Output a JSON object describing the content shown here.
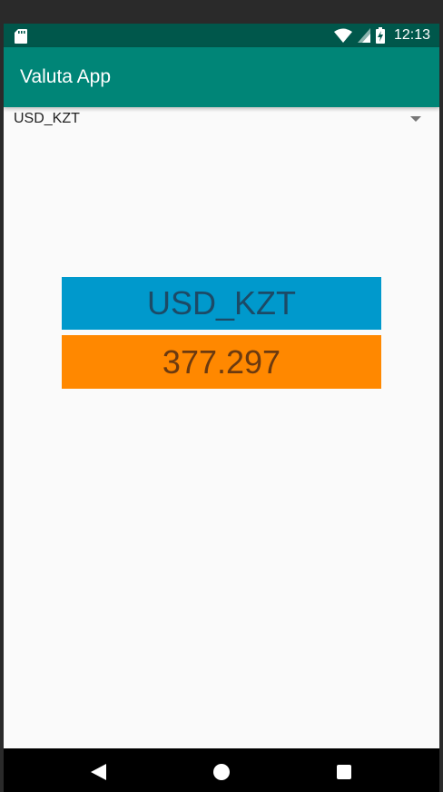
{
  "status_bar": {
    "time": "12:13",
    "icons": [
      "sd-card-icon",
      "wifi-icon",
      "signal-icon",
      "battery-charging-icon"
    ]
  },
  "app_bar": {
    "title": "Valuta App"
  },
  "spinner": {
    "selected": "USD_KZT"
  },
  "result": {
    "pair": "USD_KZT",
    "rate": "377.297"
  },
  "colors": {
    "status_bar": "#00574b",
    "app_bar": "#008577",
    "pair_box": "#0099cc",
    "rate_box": "#ff8800",
    "background": "#fafafa"
  },
  "nav_bar": {
    "buttons": [
      "back-icon",
      "home-icon",
      "recents-icon"
    ]
  }
}
